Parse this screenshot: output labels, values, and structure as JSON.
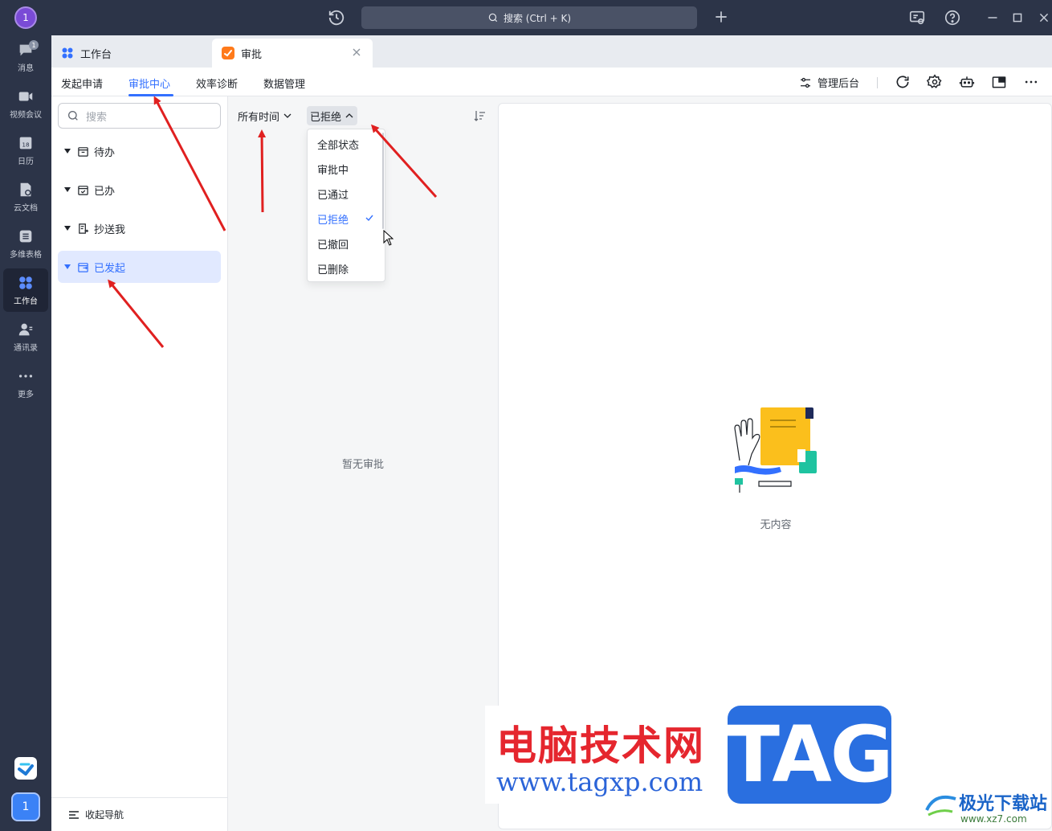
{
  "topbar": {
    "avatar": "1",
    "search_placeholder": "搜索 (Ctrl + K)"
  },
  "leftnav": {
    "items": [
      {
        "label": "消息",
        "icon": "chat-icon",
        "badge": "1"
      },
      {
        "label": "视频会议",
        "icon": "video-icon"
      },
      {
        "label": "日历",
        "icon": "calendar-icon",
        "day": "18"
      },
      {
        "label": "云文档",
        "icon": "cloud-doc-icon"
      },
      {
        "label": "多维表格",
        "icon": "table-icon"
      },
      {
        "label": "工作台",
        "icon": "workbench-icon",
        "active": true
      },
      {
        "label": "通讯录",
        "icon": "contacts-icon"
      },
      {
        "label": "更多",
        "icon": "more-icon"
      }
    ],
    "user_badge": "1"
  },
  "tabs": [
    {
      "label": "工作台",
      "icon": "workbench-icon"
    },
    {
      "label": "审批",
      "icon": "approval-icon",
      "active": true
    }
  ],
  "subnav": {
    "items": [
      "发起申请",
      "审批中心",
      "效率诊断",
      "数据管理"
    ],
    "active": "审批中心",
    "admin_label": "管理后台"
  },
  "sidebar": {
    "search_placeholder": "搜索",
    "items": [
      {
        "label": "待办"
      },
      {
        "label": "已办"
      },
      {
        "label": "抄送我"
      },
      {
        "label": "已发起",
        "active": true
      }
    ],
    "collapse_label": "收起导航"
  },
  "list": {
    "time_filter": "所有时间",
    "status_filter": "已拒绝",
    "empty_text": "暂无审批",
    "status_options": [
      "全部状态",
      "审批中",
      "已通过",
      "已拒绝",
      "已撤回",
      "已删除"
    ],
    "selected_option": "已拒绝"
  },
  "detail": {
    "empty_text": "无内容"
  },
  "watermark": {
    "title": "电脑技术网",
    "url": "www.tagxp.com",
    "tag": "TAG",
    "logo": "极光下载站",
    "logo_url": "www.xz7.com"
  },
  "colors": {
    "accent": "#3370ff",
    "nav_bg": "#2c3448",
    "arrow": "#e02020"
  }
}
